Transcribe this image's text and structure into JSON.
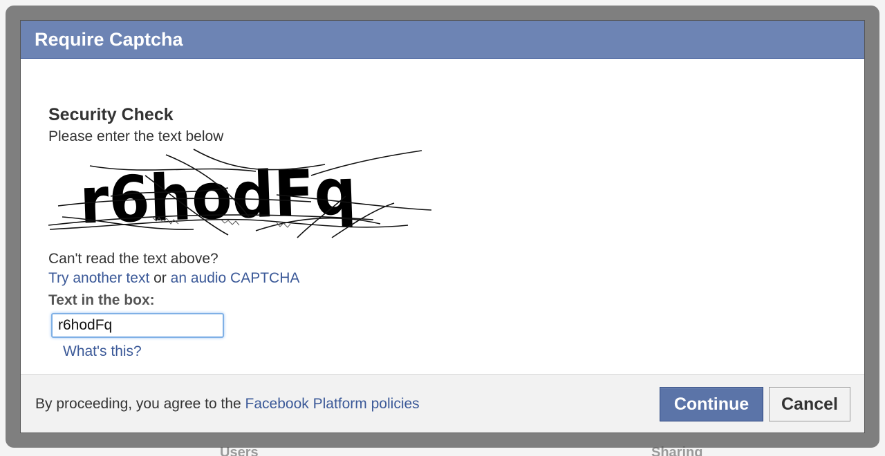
{
  "background": {
    "labels": [
      "Users",
      "Sharing"
    ]
  },
  "dialog": {
    "title": "Require Captcha",
    "security_title": "Security Check",
    "instruction": "Please enter the text below",
    "captcha_text": "r6hodFq",
    "cant_read": "Can't read the text above?",
    "try_another_link": "Try another text",
    "or_text": " or ",
    "audio_link": "an audio CAPTCHA",
    "field_label": "Text in the box:",
    "field_value": "r6hodFq",
    "whats_this_link": "What's this?"
  },
  "footer": {
    "agreement_prefix": "By proceeding, you agree to the ",
    "policies_link": "Facebook Platform policies",
    "continue_label": "Continue",
    "cancel_label": "Cancel"
  },
  "colors": {
    "header": "#6d84b4",
    "link": "#3b5998",
    "primary_button": "#5b74a8",
    "focus_ring": "#7fb0e6"
  }
}
